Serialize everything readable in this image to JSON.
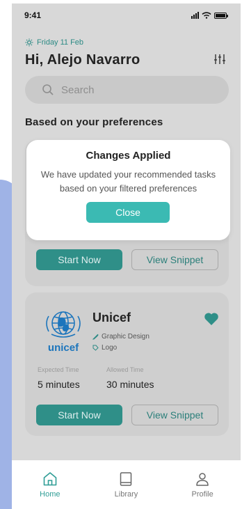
{
  "status": {
    "time": "9:41"
  },
  "header": {
    "date": "Friday 11 Feb",
    "greeting": "Hi, Alejo Navarro"
  },
  "search": {
    "placeholder": "Search"
  },
  "section": {
    "title": "Based on your preferences"
  },
  "dialog": {
    "title": "Changes Applied",
    "message": "We have updated your recommended tasks based on your filtered preferences",
    "close_label": "Close"
  },
  "cards": [
    {
      "start_label": "Start Now",
      "snippet_label": "View Snippet"
    },
    {
      "company": "Unicef",
      "logo_text": "unicef",
      "tags": [
        "Graphic Design",
        "Logo"
      ],
      "expected_label": "Expected Time",
      "allowed_label": "Allowed Time",
      "expected_value": "5 minutes",
      "allowed_value": "30 minutes",
      "start_label": "Start Now",
      "snippet_label": "View Snippet",
      "favorited": true
    }
  ],
  "nav": {
    "items": [
      {
        "label": "Home",
        "icon": "home-icon",
        "active": true
      },
      {
        "label": "Library",
        "icon": "book-icon",
        "active": false
      },
      {
        "label": "Profile",
        "icon": "user-icon",
        "active": false
      }
    ]
  },
  "colors": {
    "accent": "#2f8f88",
    "accent_light": "#3bbab3",
    "unicef_blue": "#1c75bc",
    "background_left": "#9fb3e6"
  }
}
